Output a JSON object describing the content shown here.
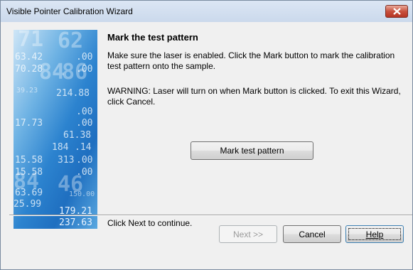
{
  "window": {
    "title": "Visible Pointer Calibration Wizard"
  },
  "banner": {
    "numbers": [
      "71",
      "62",
      "63.42",
      ".00",
      "70.28",
      ".00",
      "84",
      "86",
      "39.23",
      "214.88",
      ".00",
      "17.73",
      ".00",
      "61.38",
      "184",
      ".14",
      "15.58",
      "313",
      ".00",
      "15.58",
      ".00",
      "84",
      "46",
      "63.69",
      "150.00",
      "25.99",
      "179.21",
      "237.63"
    ]
  },
  "page": {
    "heading": "Mark the test pattern",
    "instructions": "Make sure the laser is enabled. Click the Mark button to mark the calibration test pattern onto the sample.",
    "warning": "WARNING: Laser will turn on when Mark button is clicked. To exit this Wizard, click Cancel.",
    "mark_button": "Mark test pattern",
    "continue_text": "Click Next to continue."
  },
  "buttons": {
    "next": "Next >>",
    "cancel": "Cancel",
    "help": "Help"
  },
  "colors": {
    "close_button": "#c8503d",
    "banner": "#2c83cf"
  }
}
